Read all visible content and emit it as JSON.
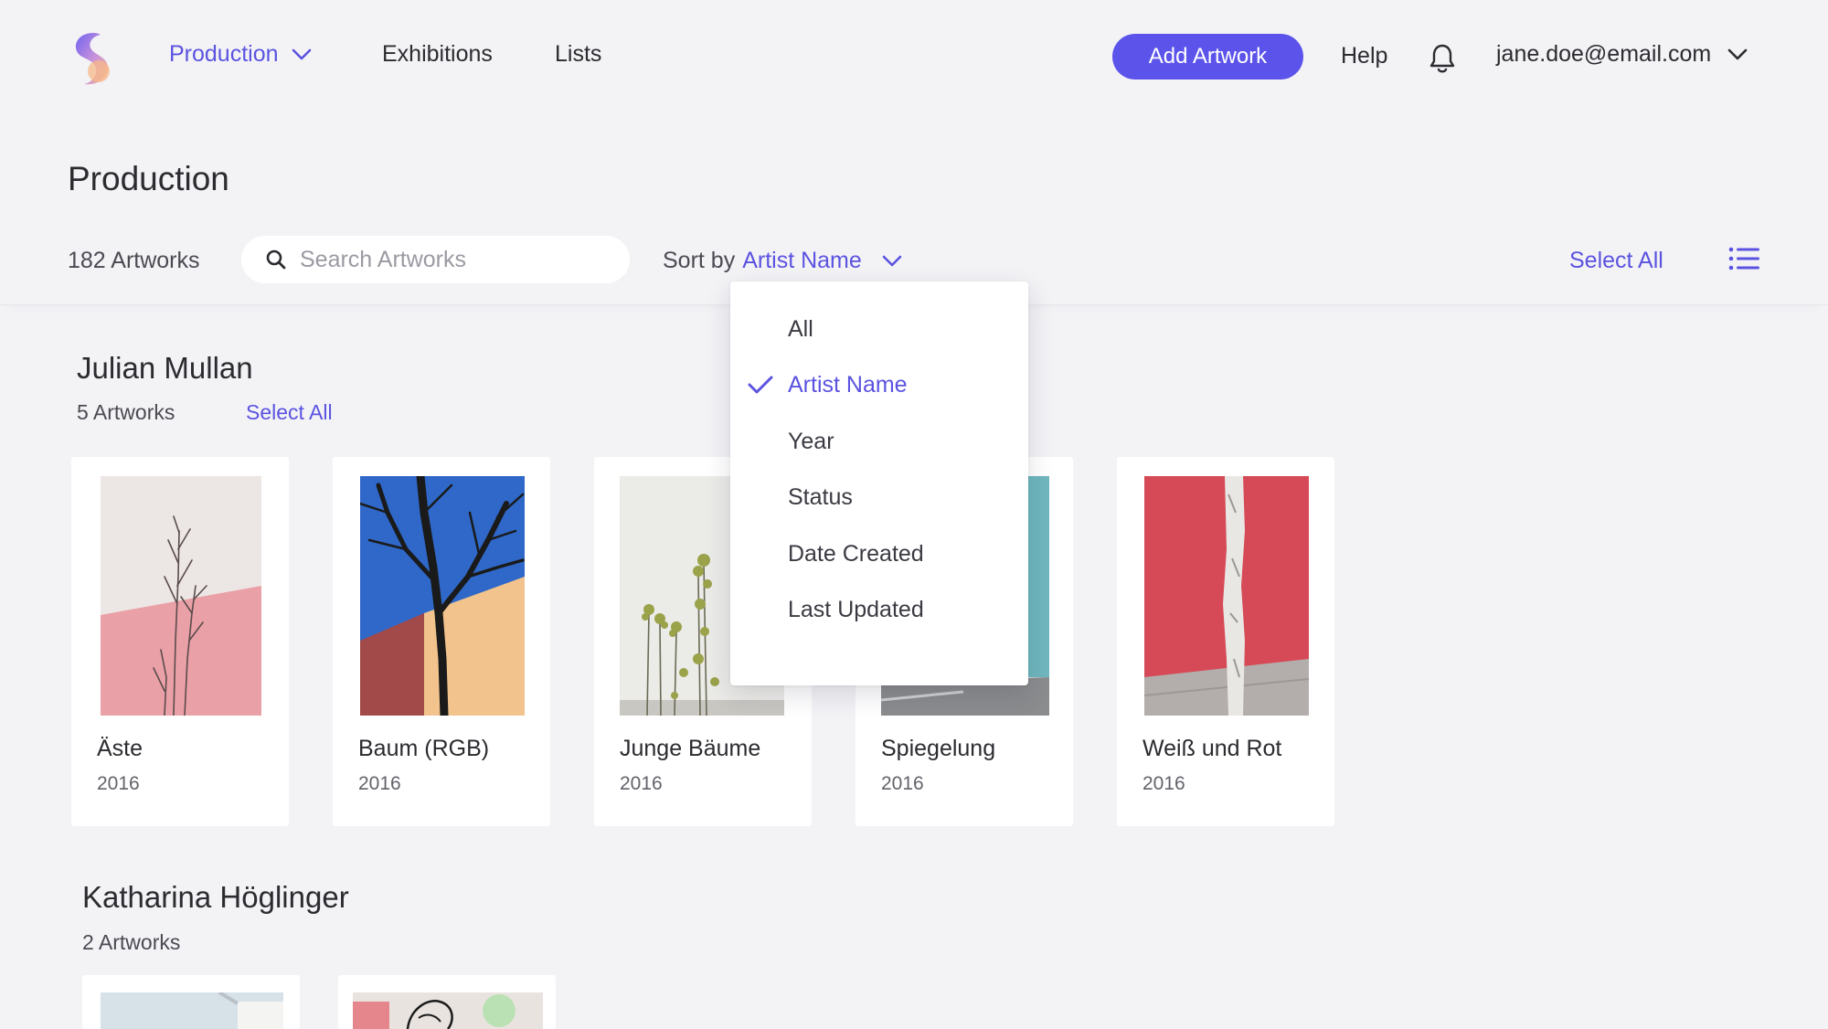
{
  "nav": {
    "production": "Production",
    "exhibitions": "Exhibitions",
    "lists": "Lists",
    "add_artwork": "Add Artwork",
    "help": "Help",
    "user_email": "jane.doe@email.com"
  },
  "page_title": "Production",
  "toolbar": {
    "count": "182 Artworks",
    "search_placeholder": "Search Artworks",
    "sort_prefix": "Sort by",
    "sort_value": "Artist Name",
    "select_all": "Select All"
  },
  "sort_menu": {
    "options": [
      "All",
      "Artist Name",
      "Year",
      "Status",
      "Date Created",
      "Last Updated"
    ],
    "selected": "Artist Name"
  },
  "groups": [
    {
      "artist": "Julian Mullan",
      "count": "5 Artworks",
      "select_all": "Select All",
      "artworks": [
        {
          "title": "Äste",
          "year": "2016"
        },
        {
          "title": "Baum (RGB)",
          "year": "2016"
        },
        {
          "title": "Junge Bäume",
          "year": "2016"
        },
        {
          "title": "Spiegelung",
          "year": "2016"
        },
        {
          "title": "Weiß und Rot",
          "year": "2016"
        }
      ]
    },
    {
      "artist": "Katharina Höglinger",
      "count": "2 Artworks"
    }
  ],
  "colors": {
    "accent": "#5b53ea",
    "background": "#f3f3f6"
  }
}
